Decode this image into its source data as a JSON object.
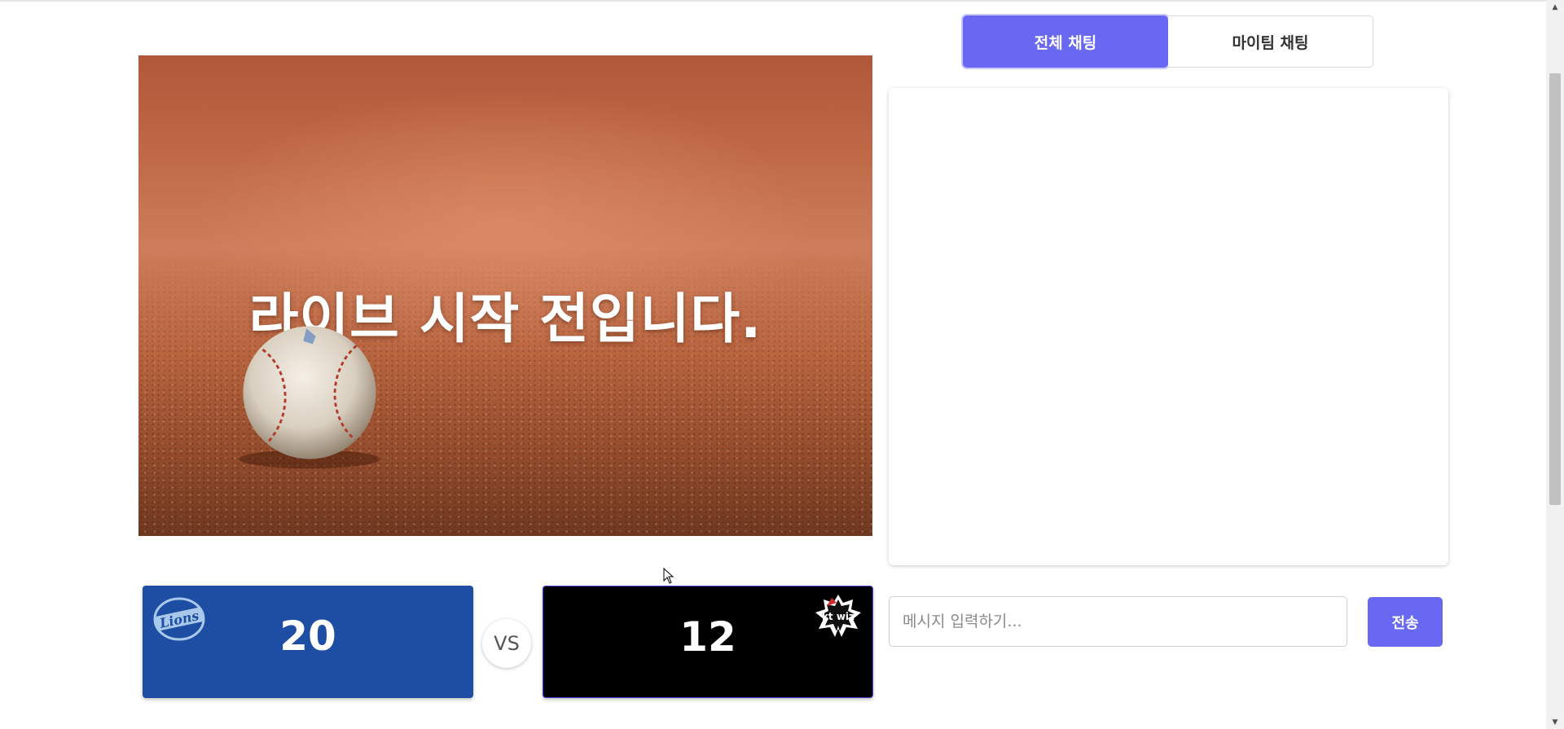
{
  "stream": {
    "status_message": "라이브 시작 전입니다."
  },
  "scoreboard": {
    "home": {
      "team_logo": "lions-logo-icon",
      "score": "20",
      "color": "#1d4ea3"
    },
    "vs_label": "VS",
    "away": {
      "team_logo": "kt-wiz-logo-icon",
      "score": "12",
      "color": "#000000"
    }
  },
  "chat": {
    "tabs": [
      {
        "label": "전체 채팅",
        "active": true
      },
      {
        "label": "마이팀 채팅",
        "active": false
      }
    ],
    "input_placeholder": "메시지 입력하기...",
    "send_label": "전송"
  },
  "colors": {
    "accent": "#6868f2",
    "home_team": "#1d4ea3",
    "away_team": "#000000"
  }
}
